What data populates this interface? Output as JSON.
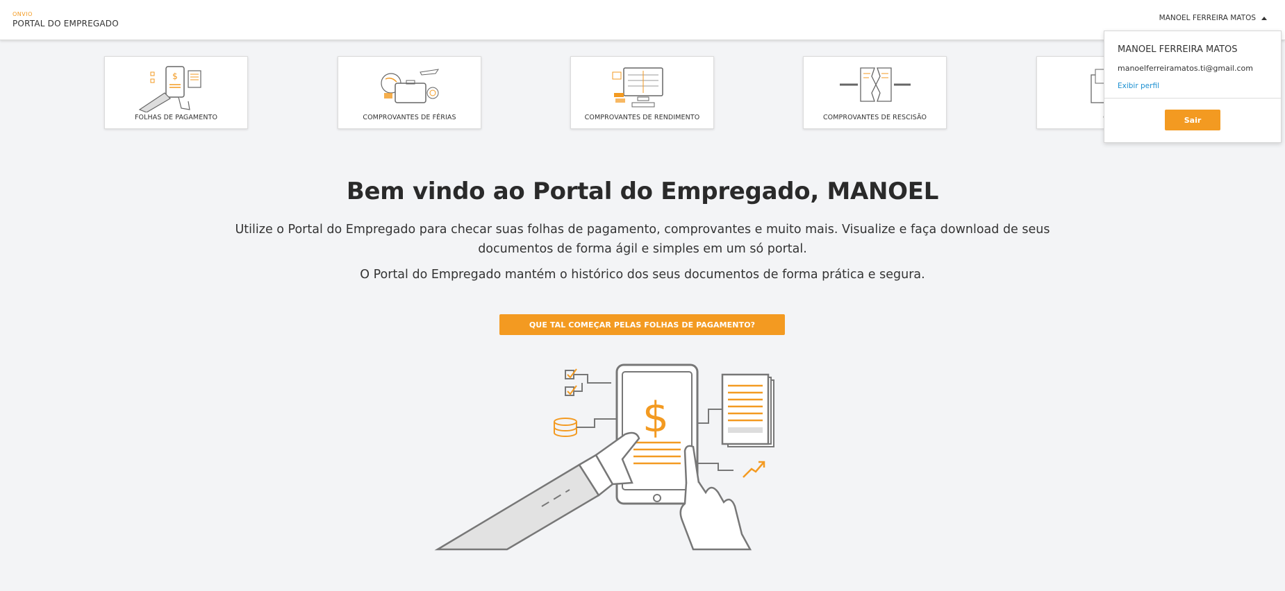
{
  "header": {
    "brand_small": "ONVIO",
    "brand_title": "PORTAL DO EMPREGADO",
    "user_name": "MANOEL FERREIRA MATOS"
  },
  "user_dropdown": {
    "name": "MANOEL FERREIRA MATOS",
    "email": "manoelferreiramatos.ti@gmail.com",
    "profile_link": "Exibir perfil",
    "logout_label": "Sair"
  },
  "cards": [
    {
      "label": "FOLHAS DE PAGAMENTO",
      "icon": "payroll-icon"
    },
    {
      "label": "COMPROVANTES DE FÉRIAS",
      "icon": "vacation-icon"
    },
    {
      "label": "COMPROVANTES DE RENDIMENTO",
      "icon": "income-icon"
    },
    {
      "label": "COMPROVANTES DE RESCISÃO",
      "icon": "termination-icon"
    },
    {
      "label": "OU",
      "icon": "other-documents-icon"
    }
  ],
  "main": {
    "welcome": "Bem vindo ao Portal do Empregado, MANOEL",
    "intro": "Utilize o Portal do Empregado para checar suas folhas de pagamento, comprovantes e muito mais. Visualize e faça download de seus documentos de forma ágil e simples em um só portal.",
    "intro2": "O Portal do Empregado mantém o histórico dos seus documentos de forma prática e segura.",
    "cta_label": "QUE TAL COMEÇAR PELAS FOLHAS DE PAGAMENTO?"
  },
  "colors": {
    "accent": "#f39a21",
    "link": "#1a8fd1",
    "background": "#f3f4f6"
  }
}
